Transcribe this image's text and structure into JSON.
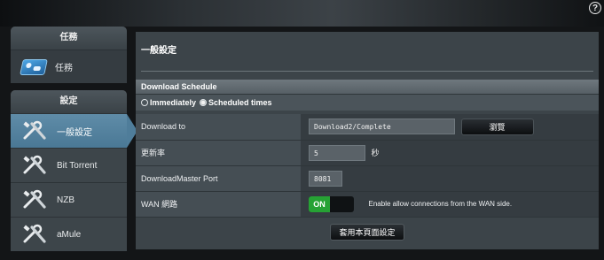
{
  "help_icon": "question-icon",
  "sidebar": {
    "tasks": {
      "header": "任務",
      "items": [
        {
          "label": "任務",
          "icon": "tasks-icon"
        }
      ]
    },
    "settings": {
      "header": "設定",
      "items": [
        {
          "label": "一般設定",
          "icon": "tools-icon",
          "active": true
        },
        {
          "label": "Bit Torrent",
          "icon": "tools-icon"
        },
        {
          "label": "NZB",
          "icon": "tools-icon"
        },
        {
          "label": "aMule",
          "icon": "tools-icon"
        }
      ]
    }
  },
  "main": {
    "title": "一般設定",
    "section": "Download Schedule",
    "schedule_options": [
      {
        "label": "Immediately",
        "checked": false
      },
      {
        "label": "Scheduled times",
        "checked": true
      }
    ],
    "rows": {
      "download_to": {
        "label": "Download to",
        "value": "Download2/Complete",
        "browse": "瀏覽"
      },
      "refresh": {
        "label": "更新率",
        "value": "5",
        "unit": "秒"
      },
      "port": {
        "label": "DownloadMaster Port",
        "value": "8081"
      },
      "wan": {
        "label": "WAN 網路",
        "toggle": "ON",
        "description": "Enable allow connections from the WAN side."
      }
    },
    "apply_label": "套用本頁面設定"
  },
  "colors": {
    "accent": "#4a7895",
    "toggle_on": "#26a234"
  }
}
